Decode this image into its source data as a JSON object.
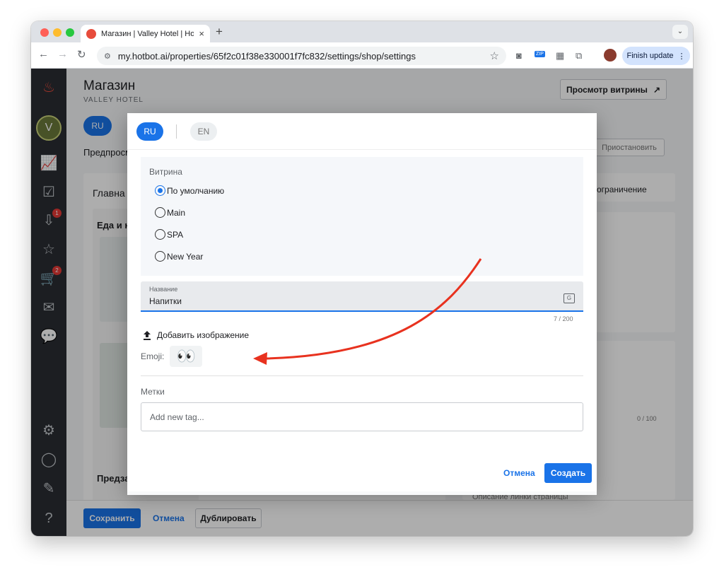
{
  "browser": {
    "tab_title": "Магазин | Valley Hotel | Hotbot",
    "tab_close": "×",
    "new_tab": "+",
    "url": "my.hotbot.ai/properties/65f2c01f38e330001f7fc832/settings/shop/settings",
    "finish_update_label": "Finish update",
    "ext_zip": "ZIP"
  },
  "sidebar": {
    "badges": {
      "inbox": "1",
      "cart": "2"
    }
  },
  "header": {
    "title": "Магазин",
    "subtitle": "VALLEY HOTEL",
    "preview_button": "Просмотр витрины",
    "preview_arrow": "↗"
  },
  "background": {
    "lang_ru": "RU",
    "preview_text": "Предпросм",
    "pause_button": "Приостановить",
    "main_heading": "Главна",
    "food_heading": "Еда и н",
    "limit_text": "ограничение",
    "counter_right": "0 / 100",
    "presale_heading": "Предза",
    "description_hint": "Описание линки страницы"
  },
  "bottom_bar": {
    "save": "Сохранить",
    "cancel": "Отмена",
    "duplicate": "Дублировать"
  },
  "modal": {
    "lang_ru": "RU",
    "lang_en": "EN",
    "showcase_label": "Витрина",
    "showcase_options": [
      {
        "label": "По умолчанию",
        "selected": true
      },
      {
        "label": "Main",
        "selected": false
      },
      {
        "label": "SPA",
        "selected": false
      },
      {
        "label": "New Year",
        "selected": false
      }
    ],
    "name_label": "Название",
    "name_value": "Напитки",
    "name_counter": "7 / 200",
    "add_image": "Добавить изображение",
    "emoji_label": "Emoji:",
    "emoji_value": "👀",
    "tags_label": "Метки",
    "tags_placeholder": "Add new tag...",
    "cancel": "Отмена",
    "create": "Создать"
  },
  "colors": {
    "accent": "#1a73e8",
    "arrow": "#e8321f",
    "sidebar": "#2a2d33"
  }
}
